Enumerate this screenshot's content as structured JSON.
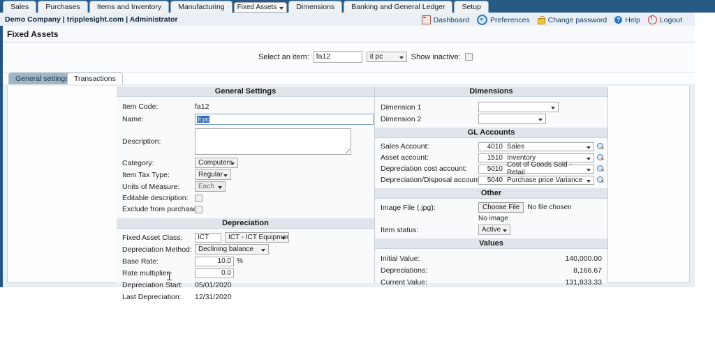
{
  "navbar": {
    "tabs": [
      {
        "label": "Sales",
        "accel": "S"
      },
      {
        "label": "Purchases",
        "accel": "P"
      },
      {
        "label": "Items and Inventory",
        "accel": "I"
      },
      {
        "label": "Manufacturing",
        "accel": "M"
      },
      {
        "label": "Fixed Assets",
        "accel": "F"
      },
      {
        "label": "Dimensions",
        "accel": "D"
      },
      {
        "label": "Banking and General Ledger",
        "accel": "B"
      },
      {
        "label": "Setup",
        "accel": "e"
      }
    ],
    "selected": "Fixed Assets",
    "bar_color": "#275a85"
  },
  "userbar": {
    "company_line": "Demo Company | tripplesight.com | Administrator",
    "tools": [
      {
        "label": "Dashboard",
        "icon": "dashboard-icon"
      },
      {
        "label": "Preferences",
        "icon": "gear-icon"
      },
      {
        "label": "Change password",
        "icon": "lock-icon"
      },
      {
        "label": "Help",
        "icon": "help-icon"
      },
      {
        "label": "Logout",
        "icon": "power-icon"
      }
    ]
  },
  "page": {
    "title": "Fixed Assets",
    "select_item_label": "Select an item:",
    "item_code_value": "fa12",
    "item_dropdown_value": "it pc",
    "show_inactive_label": "Show inactive:",
    "show_inactive_checked": false
  },
  "tabs": {
    "general": "General settings",
    "transactions": "Transactions",
    "active": "General settings"
  },
  "general_settings": {
    "heading": "General Settings",
    "item_code_label": "Item Code:",
    "item_code_value": "fa12",
    "name_label": "Name:",
    "name_value": "It pc",
    "description_label": "Description:",
    "description_value": "",
    "category_label": "Category:",
    "category_value": "Computers",
    "item_tax_type_label": "Item Tax Type:",
    "item_tax_type_value": "Regular",
    "units_label": "Units of Measure:",
    "units_value": "Each",
    "editable_description_label": "Editable description:",
    "editable_description_checked": false,
    "exclude_purchases_label": "Exclude from purchases:",
    "exclude_purchases_checked": false
  },
  "depreciation": {
    "heading": "Depreciation",
    "fixed_asset_class_label": "Fixed Asset Class:",
    "fixed_asset_class_code": "ICT",
    "fixed_asset_class_value": "ICT - ICT Equipment",
    "method_label": "Depreciation Method:",
    "method_value": "Declining balance",
    "base_rate_label": "Base Rate:",
    "base_rate_value": "10.0",
    "base_rate_unit": "%",
    "rate_multiplier_label": "Rate multiplier:",
    "rate_multiplier_value": "0.0",
    "start_label": "Depreciation Start:",
    "start_value": "05/01/2020",
    "last_label": "Last Depreciation:",
    "last_value": "12/31/2020"
  },
  "dimensions": {
    "heading": "Dimensions",
    "dim1_label": "Dimension 1",
    "dim1_value": "",
    "dim2_label": "Dimension 2",
    "dim2_value": ""
  },
  "gl_accounts": {
    "heading": "GL Accounts",
    "rows": [
      {
        "label": "Sales Account:",
        "code": "4010",
        "name": "Sales"
      },
      {
        "label": "Asset account:",
        "code": "1510",
        "name": "Inventory"
      },
      {
        "label": "Depreciation cost account:",
        "code": "5010",
        "name": "Cost of Goods Sold - Retail"
      },
      {
        "label": "Depreciation/Disposal account:",
        "code": "5040",
        "name": "Purchase price Variance"
      }
    ]
  },
  "other": {
    "heading": "Other",
    "image_file_label": "Image File (.jpg):",
    "choose_file_button": "Choose File",
    "no_file_text": "No file chosen",
    "no_image_text": "No image",
    "item_status_label": "Item status:",
    "item_status_value": "Active"
  },
  "values": {
    "heading": "Values",
    "rows": [
      {
        "label": "Initial Value:",
        "amount": "140,000.00"
      },
      {
        "label": "Depreciations:",
        "amount": "8,166.67"
      },
      {
        "label": "Current Value:",
        "amount": "131,833.33"
      }
    ]
  }
}
